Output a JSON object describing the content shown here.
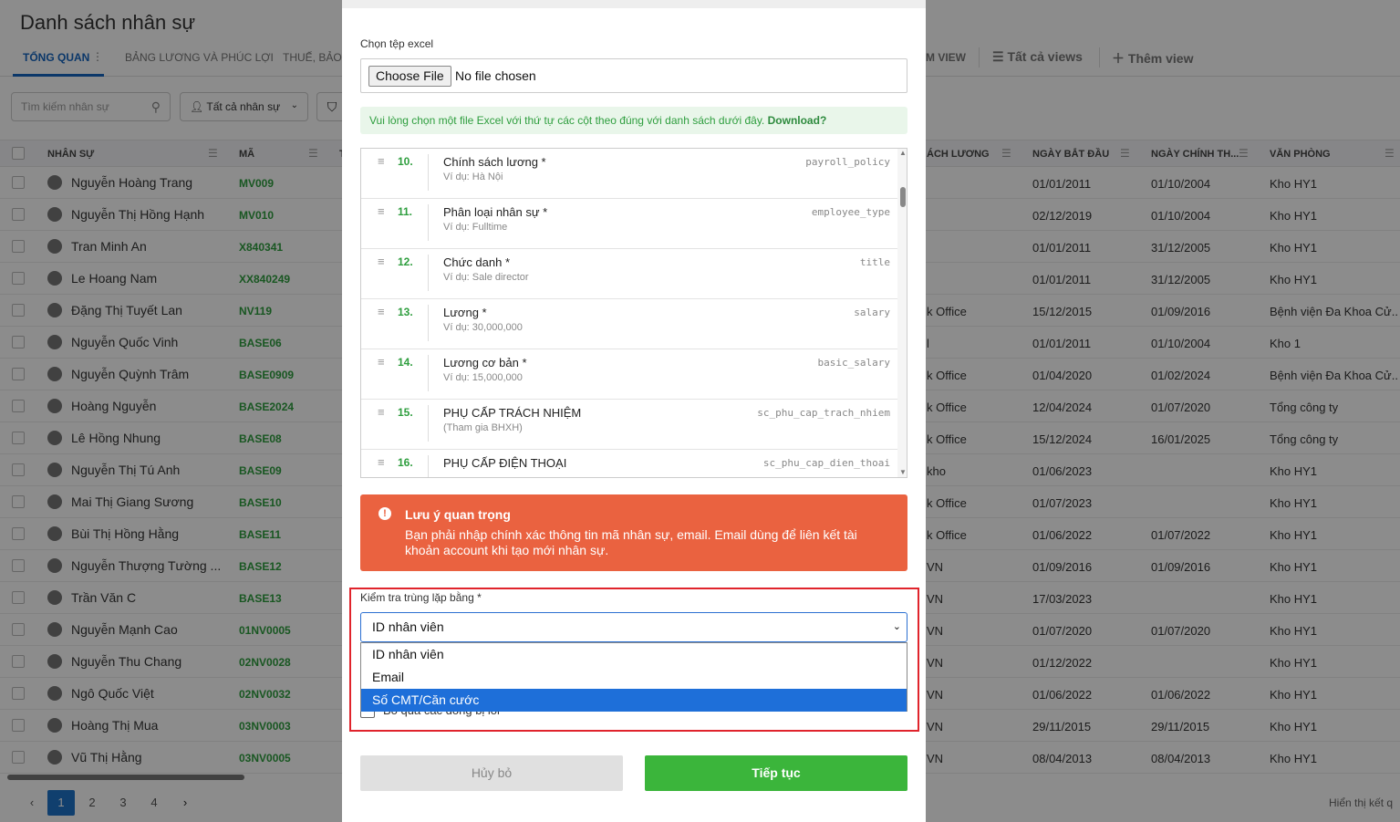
{
  "page": {
    "title": "Danh sách nhân sự",
    "tabs": [
      "TỔNG QUAN",
      "BẢNG LƯƠNG VÀ PHÚC LỢI",
      "THUẾ, BẢO"
    ],
    "views": {
      "partial": "M VIEW",
      "all_views": "Tất cả views",
      "add_view": "Thêm view"
    },
    "search_placeholder": "Tìm kiếm nhân sự",
    "filter_select": "Tất cả nhân sự",
    "columns": {
      "name": "NHÂN SỰ",
      "code": "MÃ",
      "t": "T",
      "salary_col": "ÁCH LƯƠNG",
      "start": "NGÀY BẮT ĐẦU",
      "official": "NGÀY CHÍNH TH...",
      "office": "VĂN PHÒNG"
    },
    "rows": [
      {
        "name": "Nguyễn Hoàng Trang",
        "code": "MV009",
        "dept": "",
        "start": "01/01/2011",
        "official": "01/10/2004",
        "office": "Kho HY1"
      },
      {
        "name": "Nguyễn Thị Hồng Hạnh",
        "code": "MV010",
        "dept": "",
        "start": "02/12/2019",
        "official": "01/10/2004",
        "office": "Kho HY1"
      },
      {
        "name": "Tran Minh An",
        "code": "X840341",
        "dept": "",
        "start": "01/01/2011",
        "official": "31/12/2005",
        "office": "Kho HY1"
      },
      {
        "name": "Le Hoang Nam",
        "code": "XX840249",
        "dept": "",
        "start": "01/01/2011",
        "official": "31/12/2005",
        "office": "Kho HY1"
      },
      {
        "name": "Đặng Thị Tuyết Lan",
        "code": "NV119",
        "dept": "k Office",
        "start": "15/12/2015",
        "official": "01/09/2016",
        "office": "Bệnh viện Đa Khoa Cử..."
      },
      {
        "name": "Nguyễn Quốc Vinh",
        "code": "BASE06",
        "dept": "l",
        "start": "01/01/2011",
        "official": "01/10/2004",
        "office": "Kho 1"
      },
      {
        "name": "Nguyễn Quỳnh Trâm",
        "code": "BASE0909",
        "dept": "k Office",
        "start": "01/04/2020",
        "official": "01/02/2024",
        "office": "Bệnh viện Đa Khoa Cử..."
      },
      {
        "name": "Hoàng Nguyễn",
        "code": "BASE2024",
        "dept": "k Office",
        "start": "12/04/2024",
        "official": "01/07/2020",
        "office": "Tổng công ty"
      },
      {
        "name": "Lê Hồng Nhung",
        "code": "BASE08",
        "dept": "k Office",
        "start": "15/12/2024",
        "official": "16/01/2025",
        "office": "Tổng công ty"
      },
      {
        "name": "Nguyễn Thị Tú Anh",
        "code": "BASE09",
        "dept": "kho",
        "start": "01/06/2023",
        "official": "",
        "office": "Kho HY1"
      },
      {
        "name": "Mai Thị Giang Sương",
        "code": "BASE10",
        "dept": "k Office",
        "start": "01/07/2023",
        "official": "",
        "office": "Kho HY1"
      },
      {
        "name": "Bùi Thị Hồng Hằng",
        "code": "BASE11",
        "dept": "k Office",
        "start": "01/06/2022",
        "official": "01/07/2022",
        "office": "Kho HY1"
      },
      {
        "name": "Nguyễn Thượng Tường ...",
        "code": "BASE12",
        "dept": "VN",
        "start": "01/09/2016",
        "official": "01/09/2016",
        "office": "Kho HY1"
      },
      {
        "name": "Trần Văn C",
        "code": "BASE13",
        "dept": "VN",
        "start": "17/03/2023",
        "official": "",
        "office": "Kho HY1"
      },
      {
        "name": "Nguyễn Mạnh Cao",
        "code": "01NV0005",
        "dept": "VN",
        "start": "01/07/2020",
        "official": "01/07/2020",
        "office": "Kho HY1"
      },
      {
        "name": "Nguyễn Thu Chang",
        "code": "02NV0028",
        "dept": "VN",
        "start": "01/12/2022",
        "official": "",
        "office": "Kho HY1"
      },
      {
        "name": "Ngô Quốc Việt",
        "code": "02NV0032",
        "dept": "VN",
        "start": "01/06/2022",
        "official": "01/06/2022",
        "office": "Kho HY1"
      },
      {
        "name": "Hoàng Thị Mua",
        "code": "03NV0003",
        "dept": "VN",
        "start": "29/11/2015",
        "official": "29/11/2015",
        "office": "Kho HY1"
      },
      {
        "name": "Vũ Thị Hằng",
        "code": "03NV0005",
        "dept": "VN",
        "start": "08/04/2013",
        "official": "08/04/2013",
        "office": "Kho HY1"
      }
    ],
    "pagination": {
      "pages": [
        "1",
        "2",
        "3",
        "4"
      ],
      "current": "1",
      "prev": "‹",
      "next": "›"
    },
    "result_text": "Hiển thị kết q"
  },
  "modal": {
    "file_label": "Chọn tệp excel",
    "file_button": "Choose File",
    "file_status": "No file chosen",
    "hint_text": "Vui lòng chọn một file Excel với thứ tự các cột theo đúng với danh sách dưới đây.",
    "hint_link": "Download?",
    "fields": [
      {
        "num": "10.",
        "name": "Chính sách lương *",
        "example": "Ví dụ: Hà Nội",
        "key": "payroll_policy"
      },
      {
        "num": "11.",
        "name": "Phân loại nhân sự *",
        "example": "Ví dụ: Fulltime",
        "key": "employee_type"
      },
      {
        "num": "12.",
        "name": "Chức danh *",
        "example": "Ví dụ: Sale director",
        "key": "title"
      },
      {
        "num": "13.",
        "name": "Lương *",
        "example": "Ví dụ: 30,000,000",
        "key": "salary"
      },
      {
        "num": "14.",
        "name": "Lương cơ bản *",
        "example": "Ví dụ: 15,000,000",
        "key": "basic_salary"
      },
      {
        "num": "15.",
        "name": "PHỤ CẤP TRÁCH NHIỆM",
        "example": "(Tham gia BHXH)",
        "key": "sc_phu_cap_trach_nhiem"
      },
      {
        "num": "16.",
        "name": "PHỤ CẤP ĐIỆN THOẠI",
        "example": "",
        "key": "sc_phu_cap_dien_thoai"
      }
    ],
    "warning": {
      "title": "Lưu ý quan trọng",
      "body": "Bạn phải nhập chính xác thông tin mã nhân sự, email. Email dùng để liên kết tài khoản account khi tạo mới nhân sự."
    },
    "dup_label": "Kiểm tra trùng lặp bằng *",
    "dup_selected": "ID nhân viên",
    "dup_options": [
      "ID nhân viên",
      "Email",
      "Số CMT/Căn cước"
    ],
    "dup_highlighted": "Số CMT/Căn cước",
    "skip_label": "Bỏ qua các dòng bị lỗi",
    "cancel": "Hủy bỏ",
    "continue": "Tiếp tục",
    "colors": {
      "primary_green": "#3bb53b",
      "warning": "#ea6240",
      "highlight": "#1e6fd9",
      "annotation_red": "#e0242c"
    }
  }
}
